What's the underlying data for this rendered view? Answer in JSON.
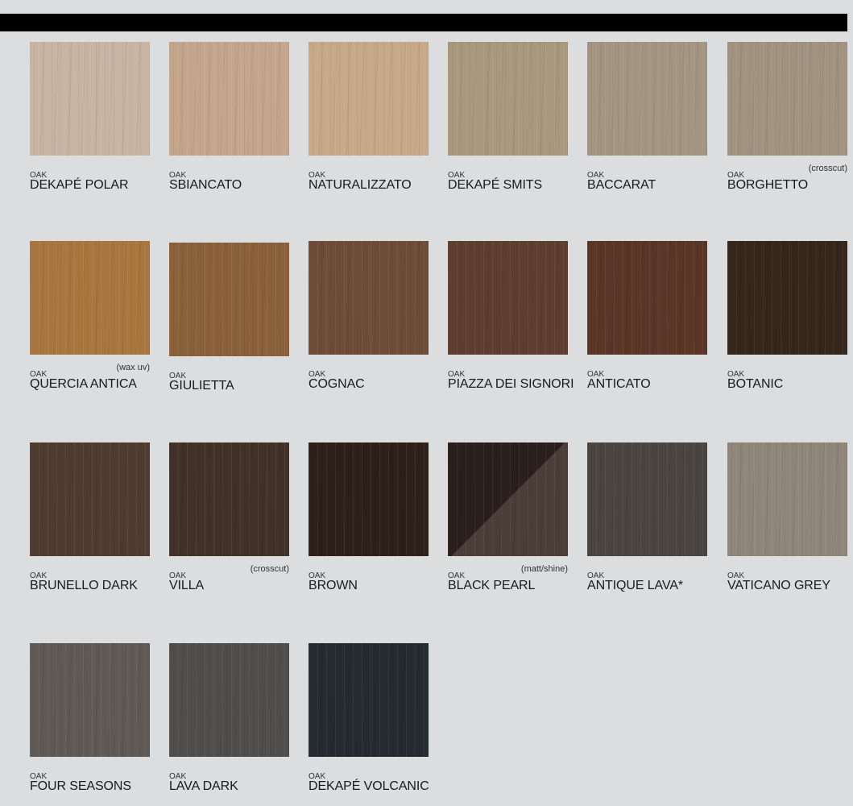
{
  "swatches": [
    {
      "species": "OAK",
      "name": "DEKAPÉ POLAR",
      "note": "",
      "color": "#c8b4a3"
    },
    {
      "species": "OAK",
      "name": "SBIANCATO",
      "note": "",
      "color": "#c3a68b"
    },
    {
      "species": "OAK",
      "name": "NATURALIZZATO",
      "note": "",
      "color": "#c7a888"
    },
    {
      "species": "OAK",
      "name": "DEKAPÉ SMITS",
      "note": "",
      "color": "#a8987d"
    },
    {
      "species": "OAK",
      "name": "BACCARAT",
      "note": "",
      "color": "#a49583"
    },
    {
      "species": "OAK",
      "name": "BORGHETTO",
      "note": "(crosscut)",
      "color": "#a19380"
    },
    {
      "species": "OAK",
      "name": "QUERCIA ANTICA",
      "note": "(wax uv)",
      "color": "#a8763f"
    },
    {
      "species": "OAK",
      "name": "GIULIETTA",
      "note": "",
      "color": "#8a6139"
    },
    {
      "species": "OAK",
      "name": "COGNAC",
      "note": "",
      "color": "#6d4d37"
    },
    {
      "species": "OAK",
      "name": "PIAZZA DEI SIGNORI",
      "note": "",
      "color": "#5e3f2f"
    },
    {
      "species": "OAK",
      "name": "ANTICATO",
      "note": "",
      "color": "#5a3626"
    },
    {
      "species": "OAK",
      "name": "BOTANIC",
      "note": "",
      "color": "#36261b"
    },
    {
      "species": "OAK",
      "name": "BRUNELLO DARK",
      "note": "",
      "color": "#4f3c31"
    },
    {
      "species": "OAK",
      "name": "VILLA",
      "note": "(crosscut)",
      "color": "#403229"
    },
    {
      "species": "OAK",
      "name": "BROWN",
      "note": "",
      "color": "#2d201b"
    },
    {
      "species": "OAK",
      "name": "BLACK PEARL",
      "note": "(matt/shine)",
      "color": "#2a1f1b",
      "color2": "#4b3d37"
    },
    {
      "species": "OAK",
      "name": "ANTIQUE LAVA*",
      "note": "",
      "color": "#4a4541"
    },
    {
      "species": "OAK",
      "name": "VATICANO GREY",
      "note": "",
      "color": "#8f857a"
    },
    {
      "species": "OAK",
      "name": "FOUR SEASONS",
      "note": "",
      "color": "#5f5a56"
    },
    {
      "species": "OAK",
      "name": "LAVA DARK",
      "note": "",
      "color": "#504e4d"
    },
    {
      "species": "OAK",
      "name": "DEKAPÉ VOLCANIC",
      "note": "",
      "color": "#262b31"
    }
  ]
}
